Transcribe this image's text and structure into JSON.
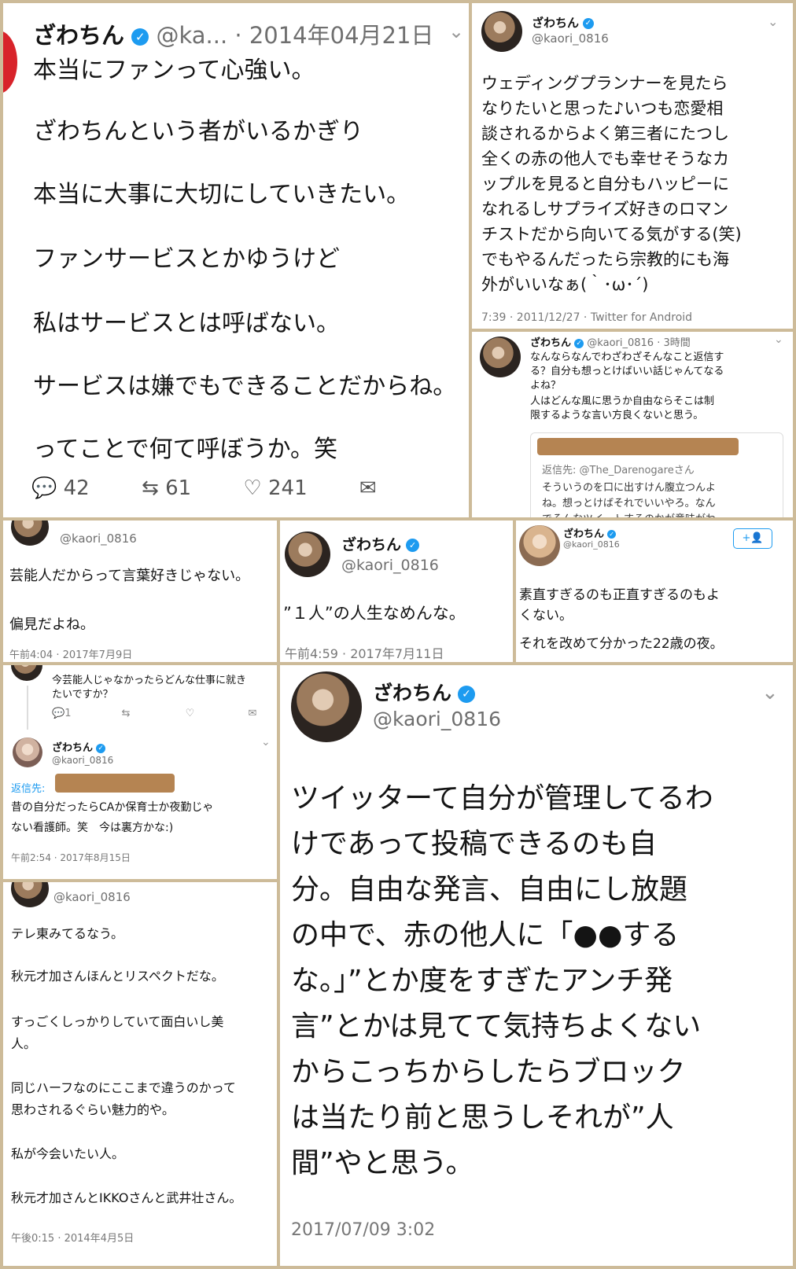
{
  "p1": {
    "name": "ざわちん",
    "handle": "@ka...",
    "date": "· 2014年04月21日",
    "lines": [
      "本当にファンって心強い。",
      "ざわちんという者がいるかぎり",
      "本当に大事に大切にしていきたい。",
      "ファンサービスとかゆうけど",
      "私はサービスとは呼ばない。",
      "サービスは嫌でもできることだからね。",
      "ってことで何て呼ぼうか。笑"
    ],
    "replies": "42",
    "retweets": "61",
    "likes": "241"
  },
  "p2": {
    "name": "ざわちん",
    "handle": "@kaori_0816",
    "lines": [
      "ウェディングプランナーを見たら",
      "なりたいと思った♪いつも恋愛相",
      "談されるからよく第三者にたつし",
      "全くの赤の他人でも幸せそうなカ",
      "ップルを見ると自分もハッピーに",
      "なれるしサプライズ好きのロマン",
      "チストだから向いてる気がする(笑)",
      "でもやるんだったら宗教的にも海",
      "外がいいなぁ(｀･ω･´)"
    ],
    "footer": "7:39 · 2011/12/27 · Twitter for Android"
  },
  "p3": {
    "name": "ざわちん",
    "handle": "@kaori_0816 · 3時間",
    "lines": [
      "なんならなんでわざわざそんなこと返信す",
      "る？自分も想っとけばいい話じゃんてなる",
      "よね？",
      "人はどんな風に思うか自由ならそこは制",
      "限するような言い方良くないと思う。"
    ],
    "reply_to": "返信先: @The_Darenogareさん",
    "quote_lines": [
      "そういうのを口に出すけん腹立つんよ",
      "ね。想っとけばそれでいいやろ。なん",
      "でそんなツイートするのかが意味がわ"
    ]
  },
  "p4": {
    "handle": "@kaori_0816",
    "lines": [
      "芸能人だからって言葉好きじゃない。",
      "偏見だよね。"
    ],
    "footer": "午前4:04 · 2017年7月9日"
  },
  "p5": {
    "name": "ざわちん",
    "handle": "@kaori_0816",
    "text": "”１人”の人生なめんな。",
    "footer": "午前4:59 · 2017年7月11日"
  },
  "p6": {
    "name": "ざわちん",
    "handle": "@kaori_0816",
    "follow": "+👤",
    "lines": [
      "素直すぎるのも正直すぎるのもよ",
      "くない。",
      "それを改めて分かった22歳の夜。"
    ]
  },
  "p7": {
    "question": [
      "今芸能人じゃなかったらどんな仕事に就き",
      "たいですか？"
    ],
    "q_replies": "1",
    "name": "ざわちん",
    "handle": "@kaori_0816",
    "reply_label": "返信先:",
    "lines": [
      "昔の自分だったらCAか保育士か夜勤じゃ",
      "ない看護師。笑　今は裏方かな:)"
    ],
    "footer": "午前2:54 · 2017年8月15日"
  },
  "p8": {
    "handle": "@kaori_0816",
    "lines": [
      "テレ東みてるなう。",
      "秋元才加さんほんとリスペクトだな。",
      "すっごくしっかりしていて面白いし美",
      "人。",
      "同じハーフなのにここまで違うのかって",
      "思わされるぐらい魅力的や。",
      "私が今会いたい人。",
      "秋元才加さんとIKKOさんと武井壮さん。"
    ],
    "footer": "午後0:15 · 2014年4月5日"
  },
  "p9": {
    "name": "ざわちん",
    "handle": "@kaori_0816",
    "lines": [
      "ツイッターて自分が管理してるわ",
      "けであって投稿できるのも自",
      "分。自由な発言、自由にし放題",
      "の中で、赤の他人に「●●する",
      "な。」”とか度をすぎたアンチ発",
      "言”とかは見てて気持ちよくない",
      "からこっちからしたらブロック",
      "は当たり前と思うしそれが”人",
      "間”やと思う。"
    ],
    "footer": "2017/07/09 3:02"
  }
}
